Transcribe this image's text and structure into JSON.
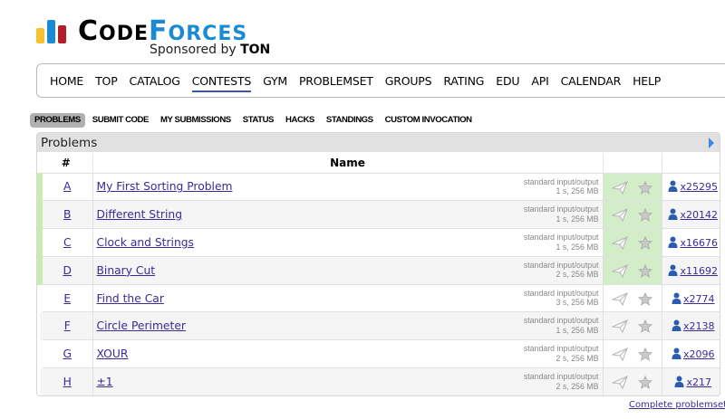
{
  "logo": {
    "word_first": "C",
    "word_rest": "ODE",
    "word_f": "F",
    "word_tail": "ORCES",
    "sponsor_prefix": "Sponsored by",
    "sponsor_name": "TON"
  },
  "main_nav": [
    "HOME",
    "TOP",
    "CATALOG",
    "CONTESTS",
    "GYM",
    "PROBLEMSET",
    "GROUPS",
    "RATING",
    "EDU",
    "API",
    "CALENDAR",
    "HELP"
  ],
  "main_nav_active": "CONTESTS",
  "sub_nav": [
    "PROBLEMS",
    "SUBMIT CODE",
    "MY SUBMISSIONS",
    "STATUS",
    "HACKS",
    "STANDINGS",
    "CUSTOM INVOCATION"
  ],
  "sub_nav_active": "PROBLEMS",
  "panel": {
    "title": "Problems",
    "col_id": "#",
    "col_name": "Name"
  },
  "problems": [
    {
      "id": "A",
      "name": "My First Sorting Problem",
      "io": "standard input/output",
      "limits": "1 s, 256 MB",
      "solved": "x25295",
      "accepted": true
    },
    {
      "id": "B",
      "name": "Different String",
      "io": "standard input/output",
      "limits": "1 s, 256 MB",
      "solved": "x20142",
      "accepted": true
    },
    {
      "id": "C",
      "name": "Clock and Strings",
      "io": "standard input/output",
      "limits": "1 s, 256 MB",
      "solved": "x16676",
      "accepted": true
    },
    {
      "id": "D",
      "name": "Binary Cut",
      "io": "standard input/output",
      "limits": "2 s, 256 MB",
      "solved": "x11692",
      "accepted": true
    },
    {
      "id": "E",
      "name": "Find the Car",
      "io": "standard input/output",
      "limits": "3 s, 256 MB",
      "solved": "x2774",
      "accepted": false
    },
    {
      "id": "F",
      "name": "Circle Perimeter",
      "io": "standard input/output",
      "limits": "1 s, 256 MB",
      "solved": "x2138",
      "accepted": false
    },
    {
      "id": "G",
      "name": "XOUR",
      "io": "standard input/output",
      "limits": "2 s, 256 MB",
      "solved": "x2096",
      "accepted": false
    },
    {
      "id": "H",
      "name": "±1",
      "io": "standard input/output",
      "limits": "2 s, 256 MB",
      "solved": "x217",
      "accepted": false
    }
  ],
  "footer": {
    "complete_link": "Complete problemset"
  },
  "icons": {
    "submit": "paper-plane-icon",
    "favorite": "star-icon",
    "solvers": "user-icon",
    "panel_toggle": "triangle-right-icon"
  },
  "colors": {
    "accepted_bg": "#d4edc9",
    "link": "#3b2a9a",
    "nav_underline": "#3b5998",
    "logo_blue": "#1a8ad4",
    "logo_red": "#b21e2b",
    "logo_yellow": "#f5c12e"
  }
}
